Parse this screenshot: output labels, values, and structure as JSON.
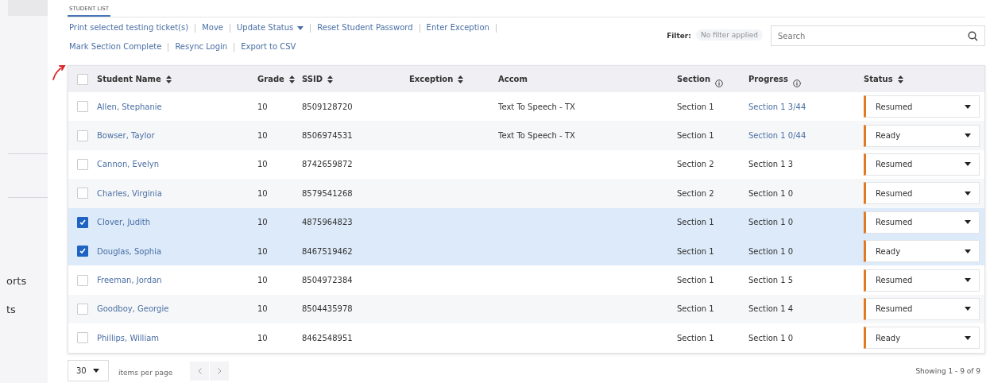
{
  "sidebar": {
    "items": [
      {
        "label": "orts"
      },
      {
        "label": "ts"
      }
    ]
  },
  "tabs": [
    {
      "label": "STUDENT LIST",
      "selected": true
    }
  ],
  "actions": [
    {
      "label": "Print selected testing ticket(s)",
      "dropdown": false
    },
    {
      "label": "Move",
      "dropdown": false
    },
    {
      "label": "Update Status",
      "dropdown": true
    },
    {
      "label": "Reset Student Password",
      "dropdown": false
    },
    {
      "label": "Enter Exception",
      "dropdown": false
    },
    {
      "label": "Mark Section Complete",
      "dropdown": false
    },
    {
      "label": "Resync Login",
      "dropdown": false
    },
    {
      "label": "Export to CSV",
      "dropdown": false
    }
  ],
  "filter": {
    "label": "Filter:",
    "value": "No filter applied"
  },
  "search": {
    "placeholder": "Search"
  },
  "table": {
    "select_all": {
      "checked": false
    },
    "columns": [
      {
        "label": "Student Name",
        "sortable": true,
        "info": false
      },
      {
        "label": "Grade",
        "sortable": true,
        "info": false
      },
      {
        "label": "SSID",
        "sortable": true,
        "info": false
      },
      {
        "label": "Exception",
        "sortable": true,
        "info": false
      },
      {
        "label": "Accom",
        "sortable": false,
        "info": false
      },
      {
        "label": "Section",
        "sortable": false,
        "info": true
      },
      {
        "label": "Progress",
        "sortable": false,
        "info": true
      },
      {
        "label": "Status",
        "sortable": true,
        "info": false
      }
    ],
    "rows": [
      {
        "selected": false,
        "name": "Allen, Stephanie",
        "grade": "10",
        "ssid": "8509128720",
        "accom": "Text To Speech - TX",
        "section": "Section 1",
        "progress": "Section 1 3/44",
        "progress_link": true,
        "status": "Resumed"
      },
      {
        "selected": false,
        "name": "Bowser, Taylor",
        "grade": "10",
        "ssid": "8506974531",
        "accom": "Text To Speech - TX",
        "section": "Section 1",
        "progress": "Section 1 0/44",
        "progress_link": true,
        "status": "Ready"
      },
      {
        "selected": false,
        "name": "Cannon, Evelyn",
        "grade": "10",
        "ssid": "8742659872",
        "section": "Section 2",
        "progress": "Section 1 3",
        "progress_link": false,
        "status": "Resumed"
      },
      {
        "selected": false,
        "name": "Charles, Virginia",
        "grade": "10",
        "ssid": "8579541268",
        "section": "Section 2",
        "progress": "Section 1 0",
        "progress_link": false,
        "status": "Resumed"
      },
      {
        "selected": true,
        "name": "Clover, Judith",
        "grade": "10",
        "ssid": "4875964823",
        "section": "Section 1",
        "progress": "Section 1 0",
        "progress_link": false,
        "status": "Resumed"
      },
      {
        "selected": true,
        "name": "Douglas, Sophia",
        "grade": "10",
        "ssid": "8467519462",
        "section": "Section 1",
        "progress": "Section 1 0",
        "progress_link": false,
        "status": "Ready"
      },
      {
        "selected": false,
        "name": "Freeman, Jordan",
        "grade": "10",
        "ssid": "8504972384",
        "section": "Section 1",
        "progress": "Section 1 5",
        "progress_link": false,
        "status": "Resumed"
      },
      {
        "selected": false,
        "name": "Goodboy, Georgie",
        "grade": "10",
        "ssid": "8504435978",
        "section": "Section 1",
        "progress": "Section 1 4",
        "progress_link": false,
        "status": "Resumed"
      },
      {
        "selected": false,
        "name": "Phillips, William",
        "grade": "10",
        "ssid": "8462548951",
        "section": "Section 1",
        "progress": "Section 1 0",
        "progress_link": false,
        "status": "Ready"
      }
    ]
  },
  "pagination": {
    "page_size": "30",
    "page_size_label": "items per page",
    "summary": "Showing 1 - 9 of 9"
  }
}
